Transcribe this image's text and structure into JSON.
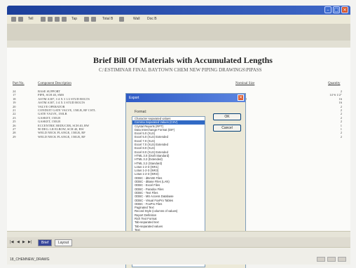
{
  "window": {
    "title": ""
  },
  "toolbar": {
    "items": [
      "Tell",
      "Tap",
      "Total B",
      "Wall",
      "Doc B"
    ]
  },
  "report": {
    "title": "Brief Bill Of Materials with Accumulated Lengths",
    "subtitle": "C:\\ESTIMINAR FINAL BAYTOWN CHEM NEW PIPING DRAWINGS\\PIPASS",
    "columns": {
      "part_no": "Part No.",
      "description": "Component Description",
      "nominal_size": "Nominal Size",
      "quantity": "Quantity"
    },
    "rows": [
      {
        "part_no": "24",
        "description": "BASE SUPPORT",
        "nominal_size": "",
        "quantity": "2"
      },
      {
        "part_no": "17",
        "description": "PIPE, SCH 40, SMS",
        "nominal_size": "",
        "quantity": "14'-6 1/2\""
      },
      {
        "part_no": "18",
        "description": "ASTM A307, 1/4 X 3 1/2 STUD BOLTS",
        "nominal_size": "3/8 x 1/2",
        "quantity": "16"
      },
      {
        "part_no": "19",
        "description": "ASTM A307, 1/4 X 3 STUD BOLTS",
        "nominal_size": "3/4",
        "quantity": "16"
      },
      {
        "part_no": "20",
        "description": "VALVE OPERATOR",
        "nominal_size": "",
        "quantity": "2"
      },
      {
        "part_no": "21",
        "description": "CONDUIT GATE VALVE, 150LB, RF CSTL",
        "nominal_size": "",
        "quantity": "2"
      },
      {
        "part_no": "22",
        "description": "GATE VALVE, 150LB",
        "nominal_size": "",
        "quantity": "2"
      },
      {
        "part_no": "23",
        "description": "GASKET, 150LB",
        "nominal_size": "",
        "quantity": "2"
      },
      {
        "part_no": "25",
        "description": "GASKET, 150LB",
        "nominal_size": "",
        "quantity": "2"
      },
      {
        "part_no": "26",
        "description": "ECCENTRIC REDUCER, SCH 40, BW",
        "nominal_size": "3 x 2",
        "quantity": "1"
      },
      {
        "part_no": "27",
        "description": "90 DEG. LR ELBOW, SCH 40, BW",
        "nominal_size": "4",
        "quantity": "1"
      },
      {
        "part_no": "28",
        "description": "WELD NECK FLANGE, 150LB, RF",
        "nominal_size": "4",
        "quantity": "2"
      },
      {
        "part_no": "29",
        "description": "WELD NECK FLANGE, 150LB, RF",
        "nominal_size": "4",
        "quantity": "2"
      }
    ]
  },
  "dialog": {
    "title": "Export",
    "format_label": "Format:",
    "ok_label": "OK",
    "cancel_label": "Cancel",
    "selected_index": 1,
    "formats": [
      "Character separated values",
      "Comma Separated Values (CSV)",
      "Crystal Reports (RPT)",
      "Data Interchange Format (DIF)",
      "Excel 5.0 (XLS)",
      "Excel 5.0 (XLS) Extended",
      "Excel 7.0 (XLS)",
      "Excel 7.0 (XLS) Extended",
      "Excel 8.0 (XLS)",
      "Excel 8.0 (XLS) Extended",
      "HTML 3.0 (Draft Standard)",
      "HTML 3.2 (Extended)",
      "HTML 3.2 (Standard)",
      "Lotus 1-2-3 (WK1)",
      "Lotus 1-2-3 (WK3)",
      "Lotus 1-2-3 (WKS)",
      "ODBC - dBASE Files",
      "ODBC - dBase Files (LAN)",
      "ODBC - Excel Files",
      "ODBC - Paradox Files",
      "ODBC - Text Files",
      "ODBC - MS Access Database",
      "ODBC - Visual FoxPro Tables",
      "ODBC - FoxPro Files",
      "Paginated Text",
      "Record Style (columns of values)",
      "Report Definition",
      "Rich Text Format",
      "Tab-separated text",
      "Tab-separated values",
      "Text",
      "Word for Windows document",
      "XML"
    ]
  },
  "tabs": {
    "items": [
      "Brief",
      "Layout"
    ],
    "active_index": 0,
    "nav": [
      "|◀",
      "◀",
      "▶",
      "▶|"
    ]
  },
  "status": {
    "text": "18_CHEMNEW_DRAWG"
  }
}
